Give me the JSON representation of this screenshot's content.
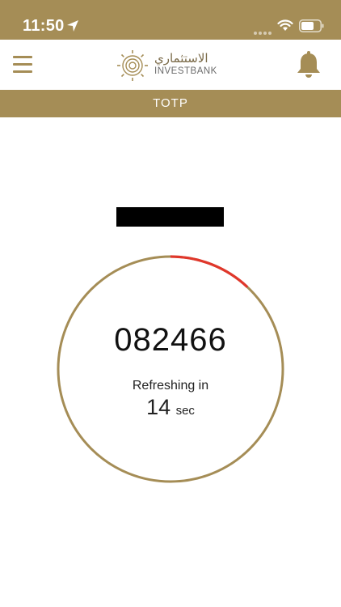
{
  "status_bar": {
    "time": "11:50",
    "location_icon": "location-arrow-icon",
    "wifi_icon": "wifi-icon",
    "battery_icon": "battery-icon",
    "background": "#a58d56"
  },
  "header": {
    "menu_icon": "hamburger-menu-icon",
    "logo_arabic": "الاستثماري",
    "logo_latin": "INVESTBANK",
    "notification_icon": "bell-icon",
    "brand_color": "#a58d56"
  },
  "title_bar": {
    "title": "TOTP"
  },
  "totp": {
    "code": "082466",
    "refresh_label": "Refreshing in",
    "seconds_remaining": "14",
    "seconds_unit": "sec",
    "elapsed_fraction": 0.12,
    "ring_color": "#a58d56",
    "elapsed_color": "#e0372b"
  }
}
